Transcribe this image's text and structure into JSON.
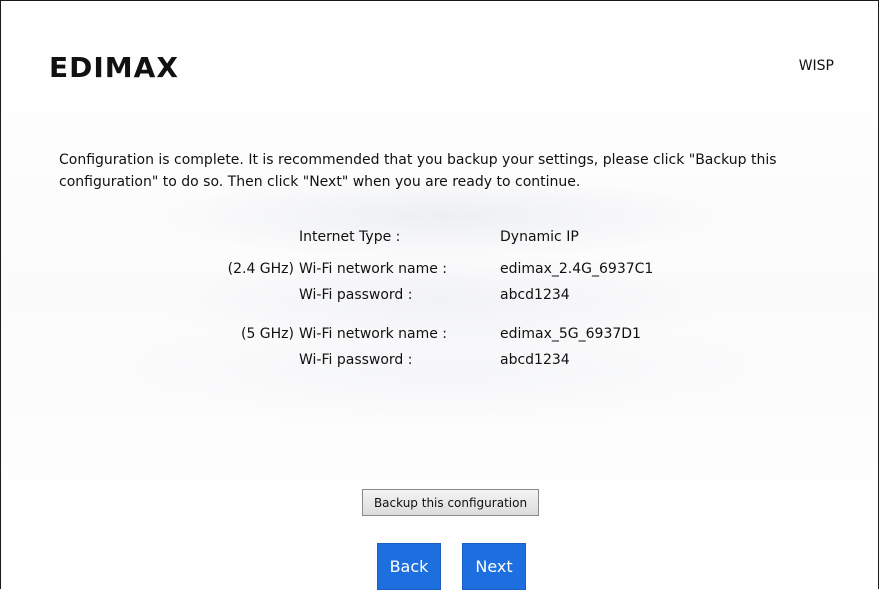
{
  "header": {
    "logo_text": "EDIMAX",
    "mode_label": "WISP"
  },
  "intro": {
    "text": "Configuration is complete. It is recommended that you backup your settings, please click \"Backup this configuration\" to do so. Then click \"Next\" when you are ready to continue."
  },
  "summary": {
    "internet_type": {
      "label": "Internet Type :",
      "value": "Dynamic IP"
    },
    "band_24": {
      "band": "(2.4 GHz)",
      "ssid_label": "Wi-Fi network name :",
      "ssid_value": "edimax_2.4G_6937C1",
      "pw_label": "Wi-Fi password :",
      "pw_value": "abcd1234"
    },
    "band_5": {
      "band": "(5 GHz)",
      "ssid_label": "Wi-Fi network name :",
      "ssid_value": "edimax_5G_6937D1",
      "pw_label": "Wi-Fi password :",
      "pw_value": "abcd1234"
    }
  },
  "buttons": {
    "backup": "Backup this configuration",
    "back": "Back",
    "next": "Next"
  },
  "colors": {
    "primary_button": "#1d6fe0",
    "logo": "#111111"
  }
}
